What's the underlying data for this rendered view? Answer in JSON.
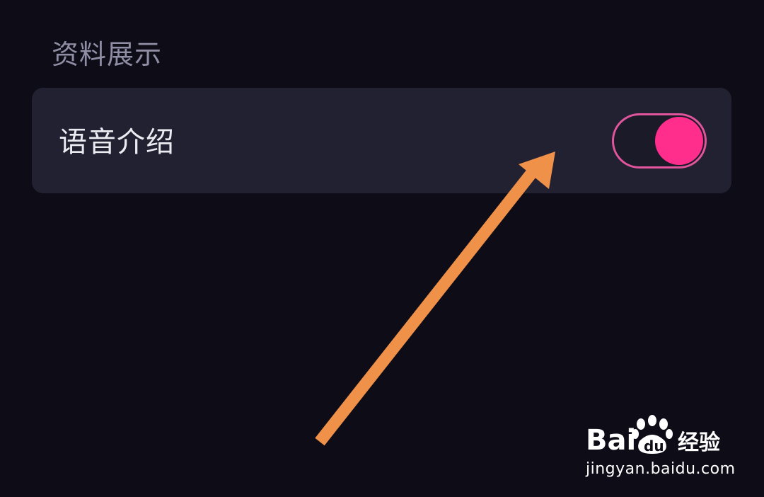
{
  "section": {
    "title": "资料展示"
  },
  "settings": {
    "voice_intro": {
      "label": "语音介绍",
      "enabled": true
    }
  },
  "colors": {
    "background": "#0d0c17",
    "card": "#222132",
    "accent": "#ff2d8c",
    "arrow": "#f0914a"
  },
  "watermark": {
    "brand": "Bai du 经验",
    "url": "jingyan.baidu.com"
  }
}
